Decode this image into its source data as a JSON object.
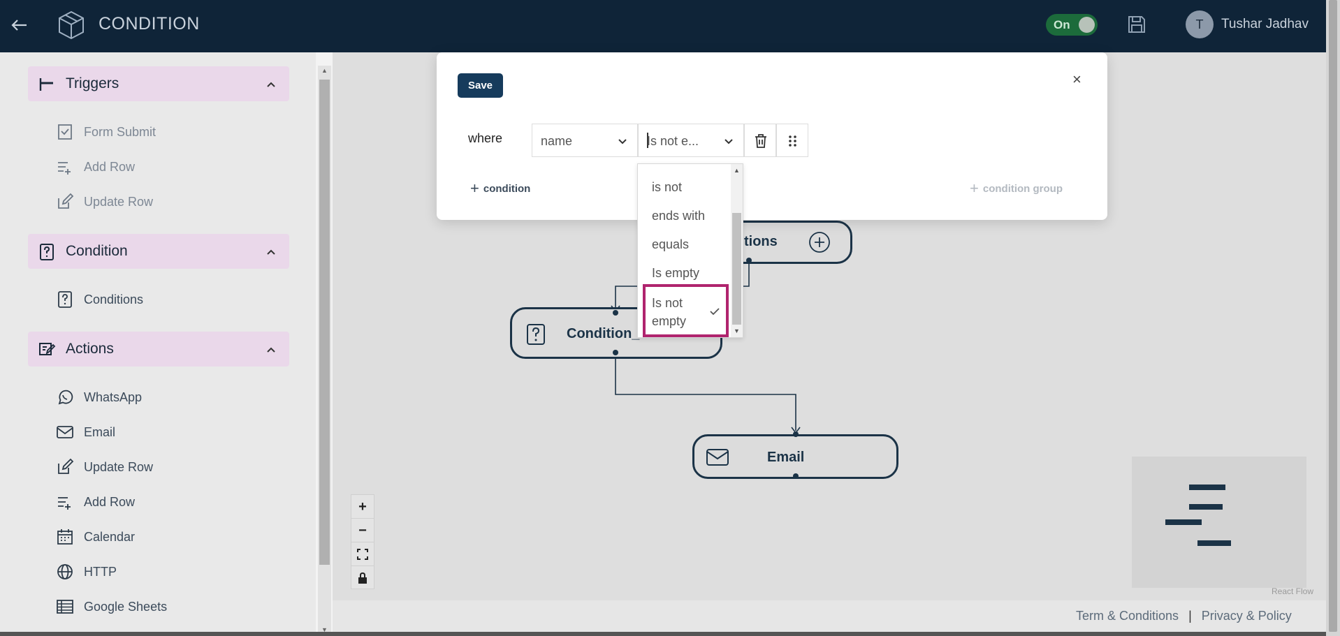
{
  "header": {
    "app_title": "CONDITION",
    "toggle_label": "On",
    "avatar_initial": "T",
    "user_name": "Tushar Jadhav"
  },
  "sidebar": {
    "sections": [
      {
        "title": "Triggers",
        "items": [
          "Form Submit",
          "Add Row",
          "Update Row"
        ]
      },
      {
        "title": "Condition",
        "items": [
          "Conditions"
        ]
      },
      {
        "title": "Actions",
        "items": [
          "WhatsApp",
          "Email",
          "Update Row",
          "Add Row",
          "Calendar",
          "HTTP",
          "Google Sheets"
        ]
      }
    ]
  },
  "canvas": {
    "nodes": {
      "conditions_node": "tions",
      "condition_node": "Condition_",
      "email_node": "Email"
    },
    "attribution": "React Flow",
    "footer": {
      "terms": "Term & Conditions",
      "privacy": "Privacy & Policy"
    }
  },
  "modal": {
    "save_label": "Save",
    "close_label": "×",
    "where_label": "where",
    "field_value": "name",
    "operator_value": "Is not e...",
    "add_condition_label": "condition",
    "add_group_label": "condition group"
  },
  "dropdown": {
    "options": [
      "is not",
      "ends with",
      "equals",
      "Is empty"
    ],
    "selected_line1": "Is not",
    "selected_line2": "empty"
  },
  "colors": {
    "topbar": "#0f2438",
    "accent": "#163b5c",
    "selection_border": "#b0246e",
    "section_header": "#ead8ea"
  }
}
